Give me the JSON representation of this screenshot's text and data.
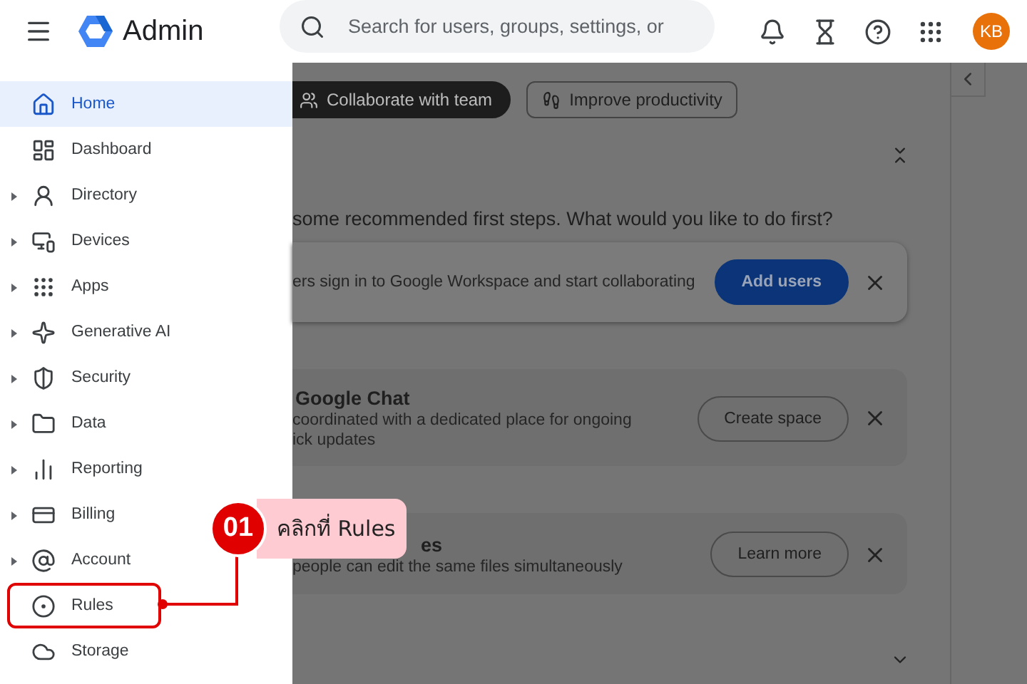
{
  "header": {
    "app_name": "Admin",
    "search": {
      "placeholder": "Search for users, groups, settings, or"
    },
    "avatar": "KB"
  },
  "sidebar": {
    "items": [
      {
        "label": "Home",
        "selected": true,
        "expandable": false,
        "highlighted": false
      },
      {
        "label": "Dashboard",
        "selected": false,
        "expandable": false,
        "highlighted": false
      },
      {
        "label": "Directory",
        "selected": false,
        "expandable": true,
        "highlighted": false
      },
      {
        "label": "Devices",
        "selected": false,
        "expandable": true,
        "highlighted": false
      },
      {
        "label": "Apps",
        "selected": false,
        "expandable": true,
        "highlighted": false
      },
      {
        "label": "Generative AI",
        "selected": false,
        "expandable": true,
        "highlighted": false
      },
      {
        "label": "Security",
        "selected": false,
        "expandable": true,
        "highlighted": false
      },
      {
        "label": "Data",
        "selected": false,
        "expandable": true,
        "highlighted": false
      },
      {
        "label": "Reporting",
        "selected": false,
        "expandable": true,
        "highlighted": false
      },
      {
        "label": "Billing",
        "selected": false,
        "expandable": true,
        "highlighted": false
      },
      {
        "label": "Account",
        "selected": false,
        "expandable": true,
        "highlighted": false
      },
      {
        "label": "Rules",
        "selected": false,
        "expandable": false,
        "highlighted": true
      },
      {
        "label": "Storage",
        "selected": false,
        "expandable": false,
        "highlighted": false
      }
    ]
  },
  "main": {
    "chips": [
      {
        "label": "Collaborate with team",
        "selected": true
      },
      {
        "label": "Improve productivity",
        "selected": false
      }
    ],
    "heading": "some recommended first steps. What would you like to do first?",
    "cards": [
      {
        "description": [
          "ers sign in to Google Workspace and start collaborating"
        ],
        "button": "Add users",
        "primary": true
      },
      {
        "title": "Google Chat",
        "description": [
          "coordinated with a dedicated place for ongoing",
          "ick updates"
        ],
        "button": "Create space",
        "primary": false
      },
      {
        "title": "es",
        "description": [
          "people can edit the same files simultaneously"
        ],
        "button": "Learn more",
        "primary": false
      }
    ]
  },
  "callout": {
    "number": "01",
    "text": "คลิกที่ Rules"
  }
}
